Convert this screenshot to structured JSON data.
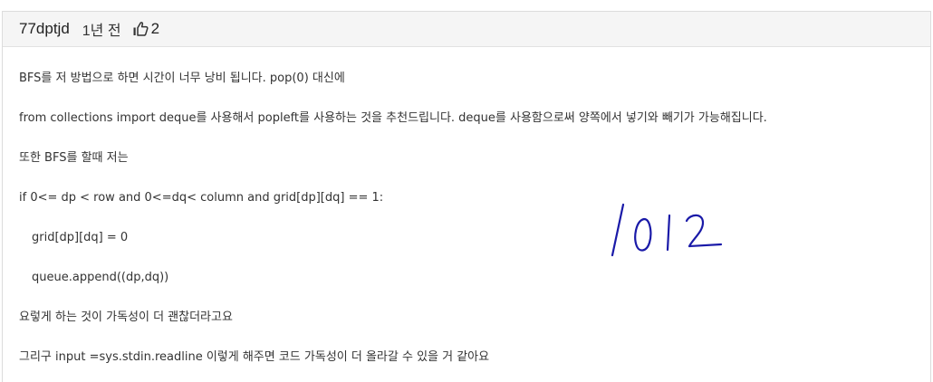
{
  "comment": {
    "author": "77dptjd",
    "time": "1년 전",
    "likes": "2",
    "like_icon": "thumbs-up-icon",
    "lines": [
      "BFS를 저 방법으로 하면 시간이 너무 낭비 됩니다. pop(0) 대신에",
      "from collections import deque를 사용해서 popleft를 사용하는 것을 추천드립니다. deque를 사용함으로써 양쪽에서 넣기와 빼기가 가능해집니다.",
      "또한 BFS를 할때 저는",
      "if 0<= dp < row and 0<=dq< column and grid[dp][dq] == 1:",
      "grid[dp][dq] = 0",
      "queue.append((dp,dq))",
      "요렇게 하는 것이 가독성이 더 괜찮더라고요",
      "그리구 input =sys.stdin.readline 이렇게 해주면 코드 가독성이 더 올라갈 수 있을 거 같아요"
    ],
    "handwritten_annotation": "1012",
    "annotation_color": "#1a1aa8"
  }
}
